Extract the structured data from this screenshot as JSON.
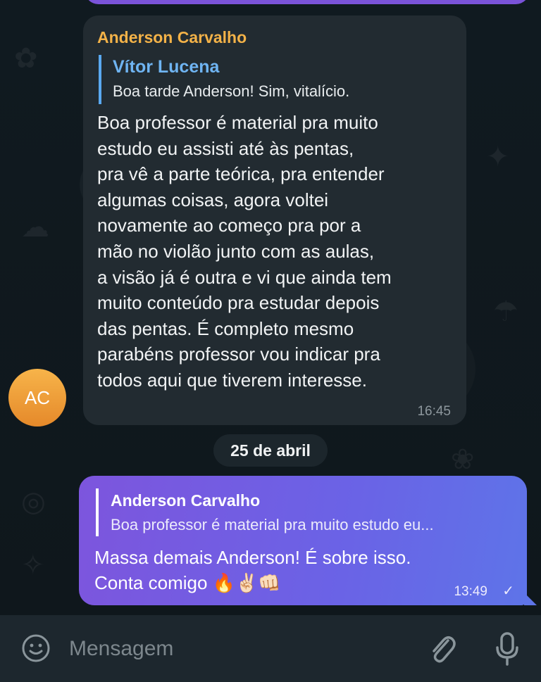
{
  "incoming_message": {
    "sender": "Anderson Carvalho",
    "reply_to": {
      "name": "Vítor Lucena",
      "text": "Boa tarde Anderson! Sim, vitalício."
    },
    "text": "Boa professor é material pra muito\nestudo eu assisti até às pentas,\npra vê a parte teórica, pra entender\nalgumas coisas, agora voltei\nnovamente ao começo pra por a\nmão no violão junto com as aulas,\na visão já é outra e vi que ainda tem\nmuito conteúdo pra estudar depois\ndas pentas. É completo mesmo\nparabéns professor vou indicar pra\ntodos aqui que tiverem interesse.",
    "time": "16:45",
    "avatar_initials": "AC"
  },
  "date_separator": "25 de abril",
  "outgoing_message": {
    "reply_to": {
      "name": "Anderson Carvalho",
      "text": "Boa professor é material pra muito estudo eu..."
    },
    "text": "Massa demais Anderson! É sobre isso.\nConta comigo 🔥✌🏻👊🏻",
    "time": "13:49",
    "status_icon": "check-icon"
  },
  "composer": {
    "placeholder": "Mensagem",
    "icons": [
      "emoji-icon",
      "attach-icon",
      "mic-icon"
    ]
  },
  "colors": {
    "background": "#0d1418",
    "incoming_bubble": "#222b31",
    "outgoing_bubble_start": "#7d55dd",
    "outgoing_bubble_end": "#5e74e8",
    "sender_name": "#f3b248",
    "reply_name": "#6fb4f2",
    "avatar": "#f0a03c"
  }
}
